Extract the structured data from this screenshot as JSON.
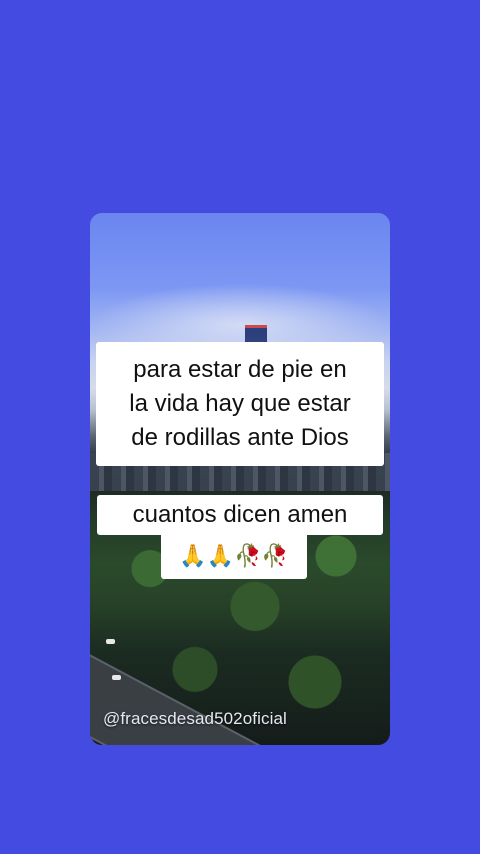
{
  "caption": {
    "lines": [
      "para estar de pie en",
      "la vida hay que estar",
      "de rodillas ante Dios"
    ]
  },
  "question": {
    "text": "cuantos dicen amen",
    "emojis": "🙏🙏🥀🥀"
  },
  "watermark": "@fracesdesad502oficial",
  "colors": {
    "background": "#434be0",
    "caption_bg": "#ffffff",
    "caption_text": "#111111"
  }
}
